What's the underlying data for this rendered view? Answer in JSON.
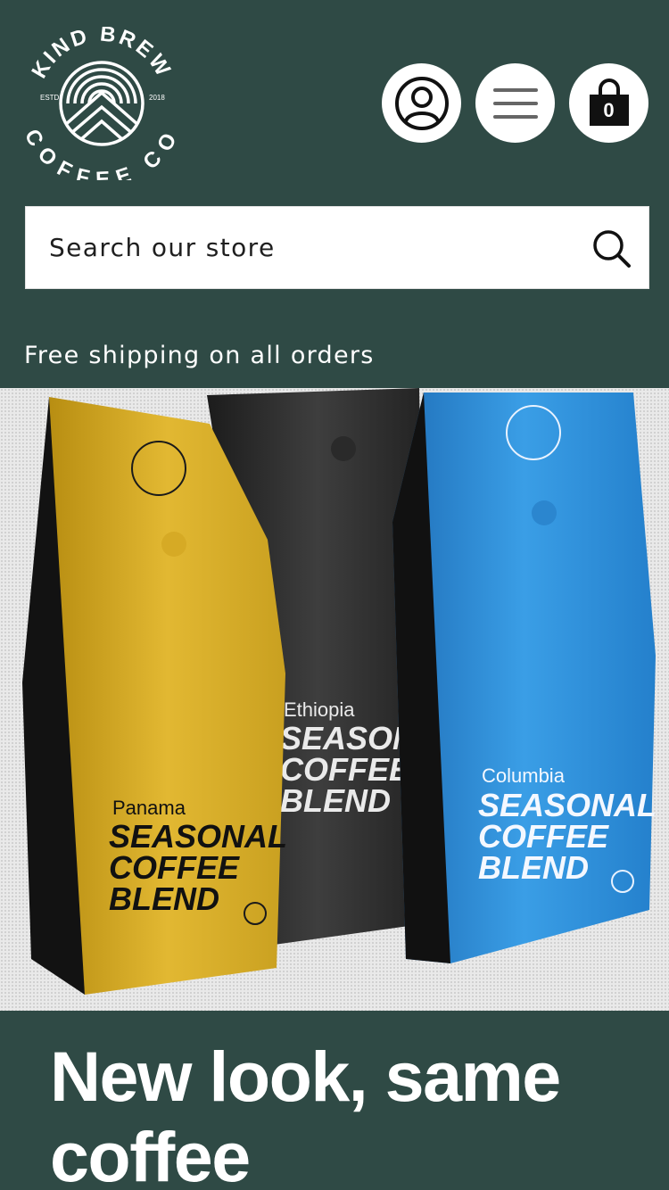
{
  "brand": {
    "logo_top_text": "KIND BREW",
    "logo_bottom_text": "COFFEE CO",
    "logo_left_text": "ESTD",
    "logo_right_text": "2018"
  },
  "header": {
    "account_icon": "account-icon",
    "menu_icon": "menu-icon",
    "cart_icon": "cart-icon",
    "cart_count": "0"
  },
  "search": {
    "placeholder": "Search our store",
    "value": "",
    "icon": "search-icon"
  },
  "promo": {
    "text": "Free shipping on all orders"
  },
  "hero": {
    "bags": [
      {
        "origin": "Panama",
        "line1": "SEASONAL",
        "line2": "COFFEE",
        "line3": "BLEND",
        "color": "#d9ad22"
      },
      {
        "origin": "Ethiopia",
        "line1": "SEASONAL",
        "line2": "COFFEE",
        "line3": "BLEND",
        "color": "#2d2d2d"
      },
      {
        "origin": "Columbia",
        "line1": "SEASONAL",
        "line2": "COFFEE",
        "line3": "BLEND",
        "color": "#2a8ed9"
      }
    ]
  },
  "headline": {
    "text": "New look, same coffee"
  },
  "colors": {
    "header_bg": "#2f4a45",
    "icon_bg": "#ffffff",
    "text_light": "#ffffff"
  }
}
